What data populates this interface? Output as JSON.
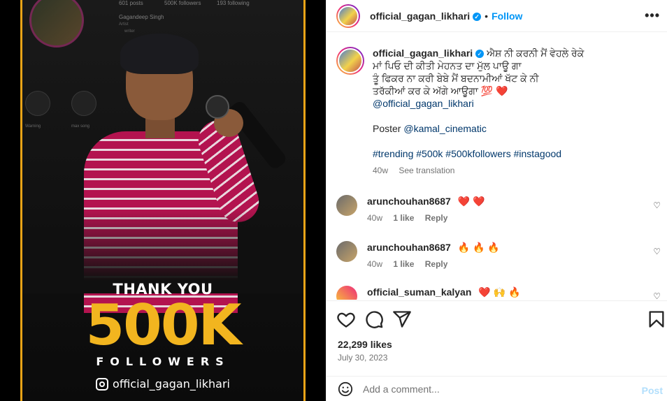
{
  "post_image": {
    "background_profile": {
      "stats": [
        "601 posts",
        "500K followers",
        "193 following"
      ],
      "name": "Gagandeep Singh",
      "role": "Artist",
      "bio_line": "writer",
      "highlight_labels": [
        "Warning",
        "max song"
      ]
    },
    "thank_you": "THANK YOU",
    "big_number": "500K",
    "followers_word": "FOLLOWERS",
    "handle": "official_gagan_likhari",
    "colors": {
      "accent": "#f2b51f",
      "border": "#e8a317",
      "shirt": "#b3134f"
    }
  },
  "header": {
    "username": "official_gagan_likhari",
    "separator": "•",
    "follow_label": "Follow",
    "more_label": "•••"
  },
  "caption": {
    "username": "official_gagan_likhari",
    "line1": "ਐਸ਼ ਨੀ ਕਰਨੀ ਮੈਂ ਵੇਹਲੇ ਰੇਕੇ",
    "line2": "ਮਾਂ ਪਿਓ ਦੀ ਕੀਤੀ ਮੇਹਨਤ ਦਾ ਮੁੱਲ ਪਾਊ ਗਾ",
    "line3": "ਤੂੰ ਫਿਕਰ ਨਾ ਕਰੀ ਬੇਬੇ ਮੈਂ ਬਦਨਾਮੀਆਂ ਖੱਟ ਕੇ ਨੀ",
    "line4": "ਤਰੱਕੀਆਂ ਕਰ ਕੇ ਅੱਗੇ ਆਊਗਾ 💯 ❤️",
    "mention": "@official_gagan_likhari",
    "poster_label": "Poster",
    "poster_mention": "@kamal_cinematic",
    "hashtags": "#trending #500k #500kfollowers #instagood",
    "time": "40w",
    "see_translation": "See translation"
  },
  "comments": [
    {
      "username": "arunchouhan8687",
      "text": "❤️ ❤️",
      "time": "40w",
      "likes": "1 like",
      "reply": "Reply"
    },
    {
      "username": "arunchouhan8687",
      "text": "🔥 🔥 🔥",
      "time": "40w",
      "likes": "1 like",
      "reply": "Reply"
    },
    {
      "username": "official_suman_kalyan",
      "text": "❤️ 🙌 🔥"
    }
  ],
  "actions": {
    "icons": [
      "heart-icon",
      "comment-icon",
      "share-icon",
      "bookmark-icon"
    ]
  },
  "likes_text": "22,299 likes",
  "date_text": "July 30, 2023",
  "add_comment": {
    "placeholder": "Add a comment...",
    "post_label": "Post"
  }
}
